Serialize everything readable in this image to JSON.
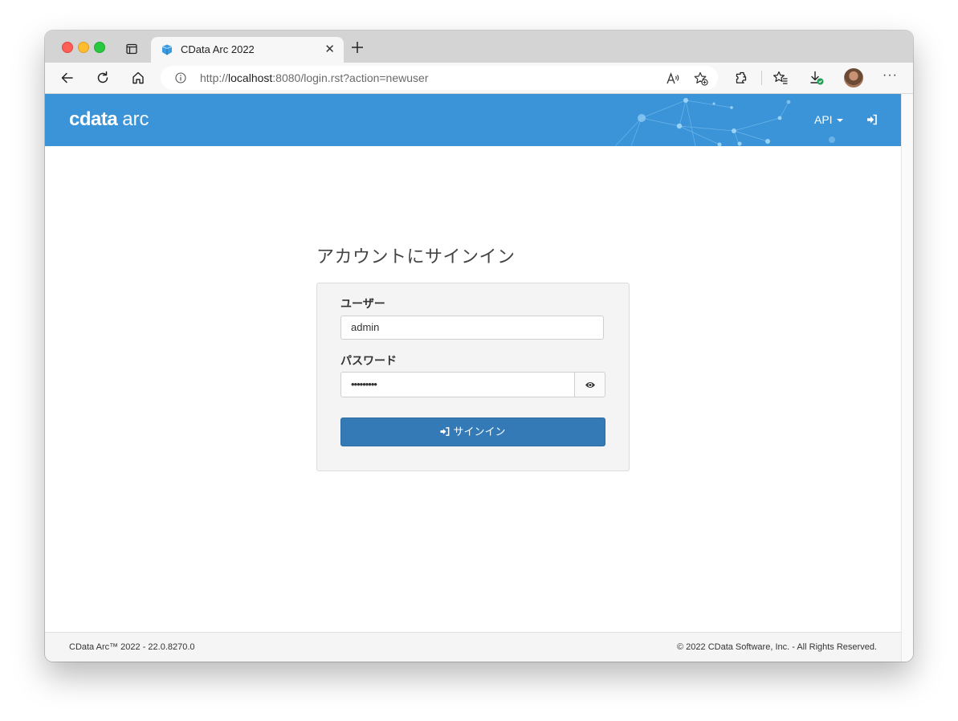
{
  "browser": {
    "tab_title": "CData Arc 2022",
    "url_prefix": "http://",
    "url_host": "localhost",
    "url_rest": ":8080/login.rst?action=newuser"
  },
  "app": {
    "logo_main": "cdata",
    "logo_sub": "arc",
    "api_menu_label": "API",
    "brand_color": "#3b94d8"
  },
  "login": {
    "heading": "アカウントにサインイン",
    "user_label": "ユーザー",
    "user_value": "admin",
    "password_label": "パスワード",
    "password_mask": "•••••••••",
    "submit_label": "サインイン",
    "button_color": "#337ab7"
  },
  "footer": {
    "version": "CData Arc™ 2022 - 22.0.8270.0",
    "copyright": "© 2022 CData Software, Inc. - All Rights Reserved."
  }
}
